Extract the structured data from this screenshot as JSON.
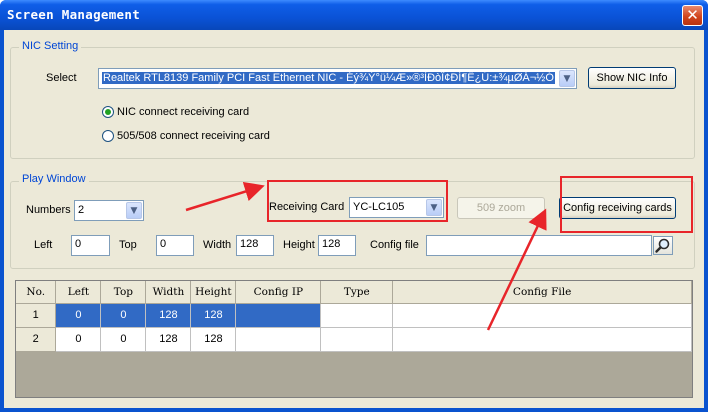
{
  "window": {
    "title": "Screen Management",
    "close_glyph": "✕"
  },
  "nic": {
    "group_title": "NIC Setting",
    "select_label": "Select",
    "nic_value": "Realtek RTL8139 Family PCI Fast Ethernet NIC - Éý¾Ý°ü¼Æ»®³ÌÐòÎ¢ÐÍ¶Ë¿Ú:±¾µØÁ¬½Ó",
    "show_info_button": "Show NIC Info",
    "radio_options": [
      {
        "label": "NIC connect receiving card",
        "checked": true
      },
      {
        "label": "505/508 connect receiving card",
        "checked": false
      }
    ]
  },
  "play": {
    "group_title": "Play Window",
    "numbers_label": "Numbers",
    "numbers_value": "2",
    "receiving_card_label": "Receiving Card",
    "receiving_card_value": "YC-LC105",
    "zoom_button": "509 zoom",
    "config_button": "Config receiving cards",
    "left_label": "Left",
    "left_value": "0",
    "top_label": "Top",
    "top_value": "0",
    "width_label": "Width",
    "width_value": "128",
    "height_label": "Height",
    "height_value": "128",
    "config_file_label": "Config file",
    "config_file_value": ""
  },
  "grid": {
    "columns": [
      "No.",
      "Left",
      "Top",
      "Width",
      "Height",
      "Config IP",
      "Type",
      "Config File"
    ],
    "rows": [
      {
        "no": "1",
        "left": "0",
        "top": "0",
        "width": "128",
        "height": "128",
        "config_ip": "",
        "type": "",
        "config_file": ""
      },
      {
        "no": "2",
        "left": "0",
        "top": "0",
        "width": "128",
        "height": "128",
        "config_ip": "",
        "type": "",
        "config_file": ""
      }
    ]
  },
  "icons": {
    "dropdown": "chevron-down-icon",
    "search": "magnifier-icon",
    "close": "close-icon"
  },
  "colors": {
    "annotation": "#e8252a",
    "selection": "#316ac5",
    "title_bar": "#0a52d6"
  }
}
